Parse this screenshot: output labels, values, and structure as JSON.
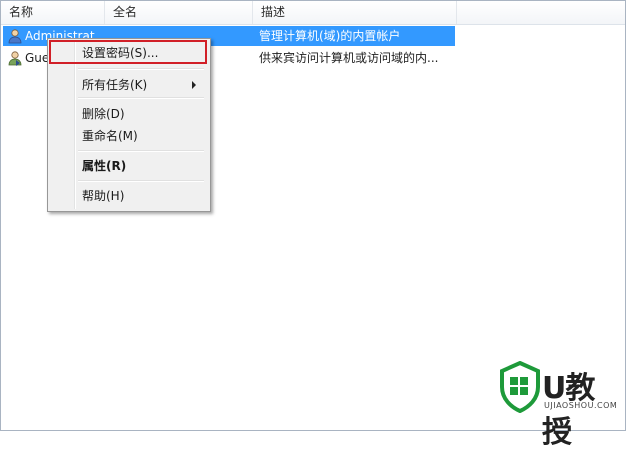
{
  "columns": {
    "name": "名称",
    "full_name": "全名",
    "description": "描述"
  },
  "rows": [
    {
      "name": "Administrat",
      "full_name": "",
      "description": "管理计算机(域)的内置帐户",
      "selected": true,
      "icon": "user-icon"
    },
    {
      "name": "Guest",
      "full_name": "",
      "description": "供来宾访问计算机或访问域的内...",
      "selected": false,
      "icon": "guest-user-icon"
    }
  ],
  "context_menu": {
    "items": [
      "设置密码(S)...",
      "所有任务(K)",
      "删除(D)",
      "重命名(M)",
      "属性(R)",
      "帮助(H)"
    ]
  },
  "watermark": {
    "title": "U教授",
    "subtitle": "UJIAOSHOU.COM"
  },
  "colors": {
    "selection": "#3399ff",
    "highlight_box": "#d11f27",
    "watermark_green": "#1e9a3a"
  }
}
